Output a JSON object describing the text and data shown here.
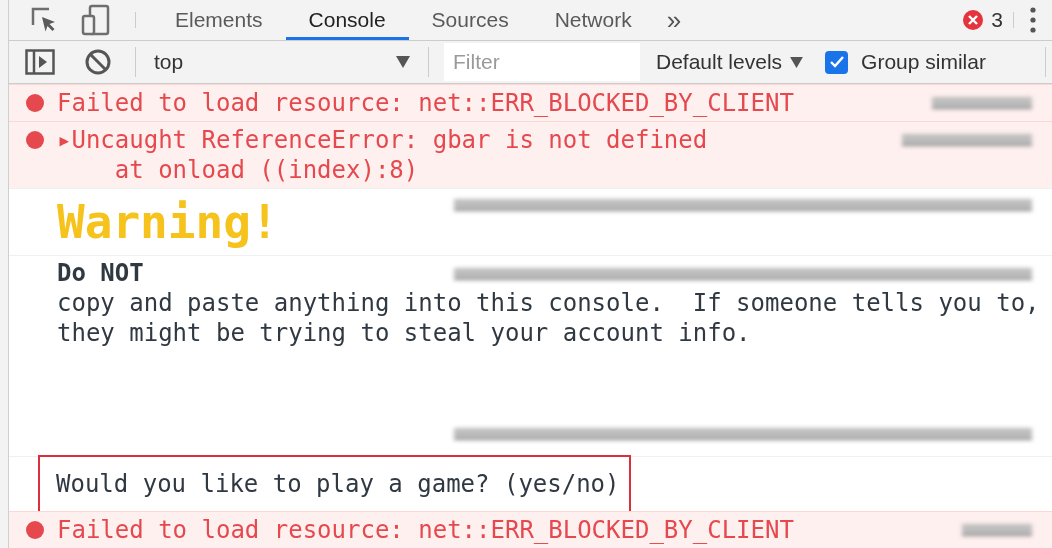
{
  "tabs": [
    {
      "label": "Elements",
      "selected": false
    },
    {
      "label": "Console",
      "selected": true
    },
    {
      "label": "Sources",
      "selected": false
    },
    {
      "label": "Network",
      "selected": false
    }
  ],
  "more_tabs": "»",
  "error_count": "3",
  "toolbar": {
    "context": "top",
    "filter_placeholder": "Filter",
    "levels": "Default levels",
    "group_similar": {
      "label": "Group similar",
      "checked": true
    }
  },
  "messages": [
    {
      "kind": "error",
      "lines": [
        "Failed to load resource: net::ERR_BLOCKED_BY_CLIENT"
      ]
    },
    {
      "kind": "error",
      "lines": [
        "▸Uncaught ReferenceError: gbar is not defined",
        "    at onload ((index):8)"
      ]
    },
    {
      "kind": "banner",
      "lines": [
        "Warning!"
      ]
    },
    {
      "kind": "log",
      "lines": [
        "**Do NOT**",
        "copy and paste anything into this console.  If someone tells you to,",
        "they might be trying to steal your account info."
      ]
    },
    {
      "kind": "source"
    },
    {
      "kind": "prompt",
      "highlighted": true,
      "lines": [
        "Would you like to play a game? (yes/no)"
      ]
    },
    {
      "kind": "error",
      "lines": [
        "Failed to load resource: net::ERR_BLOCKED_BY_CLIENT"
      ]
    }
  ]
}
